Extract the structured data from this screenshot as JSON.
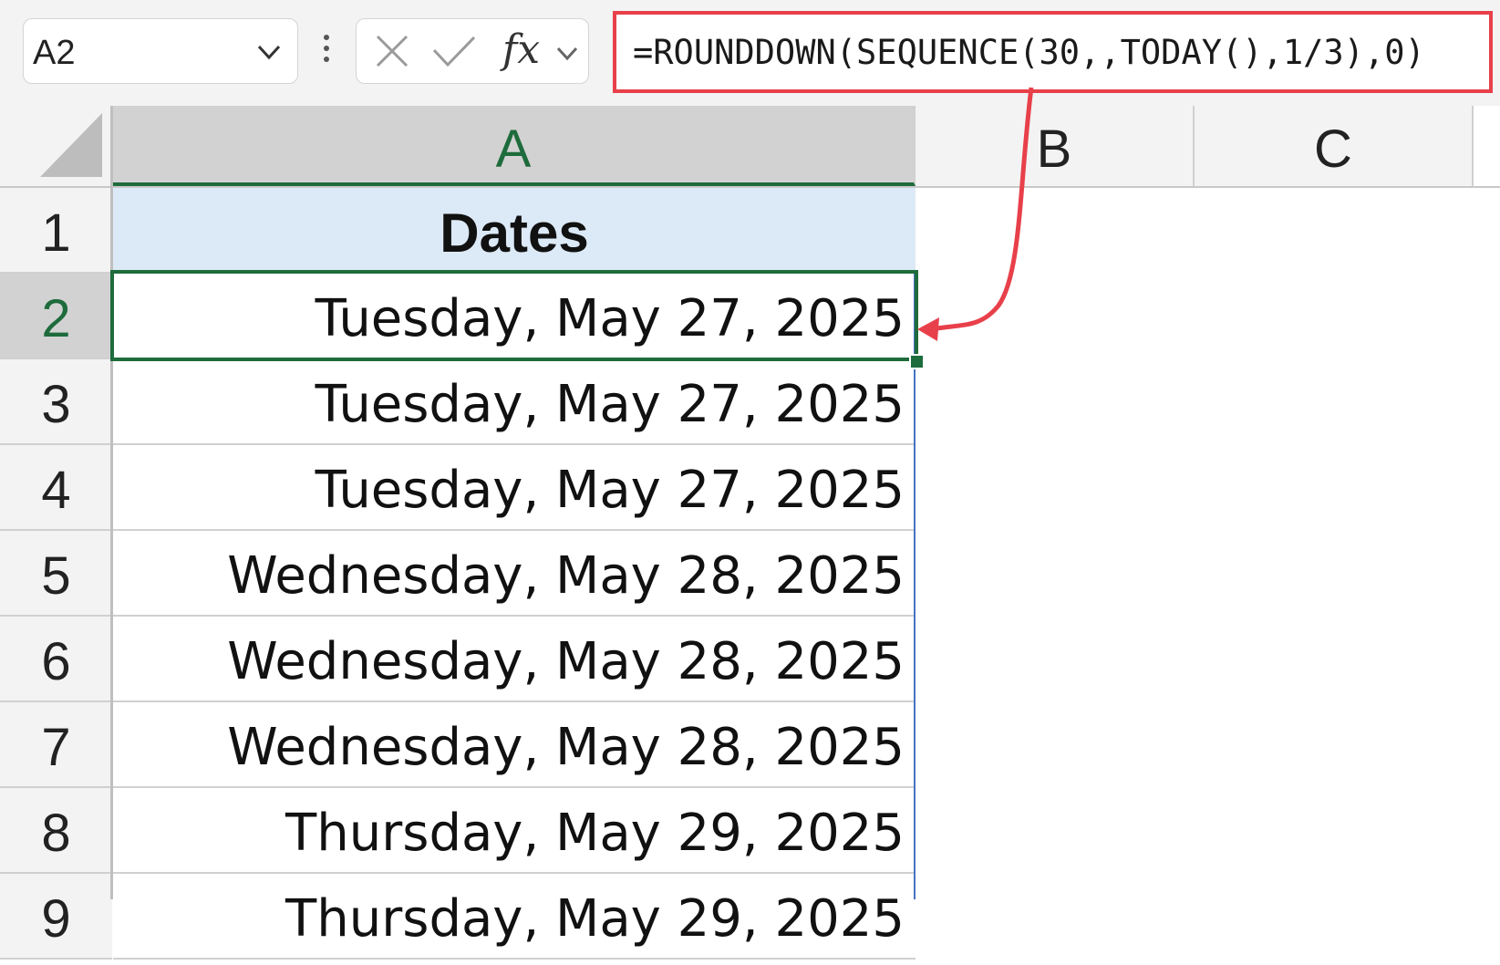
{
  "formula_bar": {
    "name_box": "A2",
    "formula": "=ROUNDDOWN(SEQUENCE(30,,TODAY(),1/3),0)",
    "icons": [
      "chevron-down-icon",
      "more-options-icon",
      "cancel-icon",
      "enter-icon",
      "insert-function-icon"
    ]
  },
  "columns": [
    "A",
    "B",
    "C"
  ],
  "active_column": "A",
  "rows": [
    {
      "num": "1",
      "value": "Dates"
    },
    {
      "num": "2",
      "value": "Tuesday, May 27, 2025"
    },
    {
      "num": "3",
      "value": "Tuesday, May 27, 2025"
    },
    {
      "num": "4",
      "value": "Tuesday, May 27, 2025"
    },
    {
      "num": "5",
      "value": "Wednesday, May 28, 2025"
    },
    {
      "num": "6",
      "value": "Wednesday, May 28, 2025"
    },
    {
      "num": "7",
      "value": "Wednesday, May 28, 2025"
    },
    {
      "num": "8",
      "value": "Thursday, May 29, 2025"
    },
    {
      "num": "9",
      "value": "Thursday, May 29, 2025"
    }
  ],
  "selected_cell": "A2",
  "colors": {
    "highlight": "#e8404a",
    "selection": "#1e6b3c",
    "header_fill": "#dce9f6",
    "spill_border": "#4472c4"
  }
}
